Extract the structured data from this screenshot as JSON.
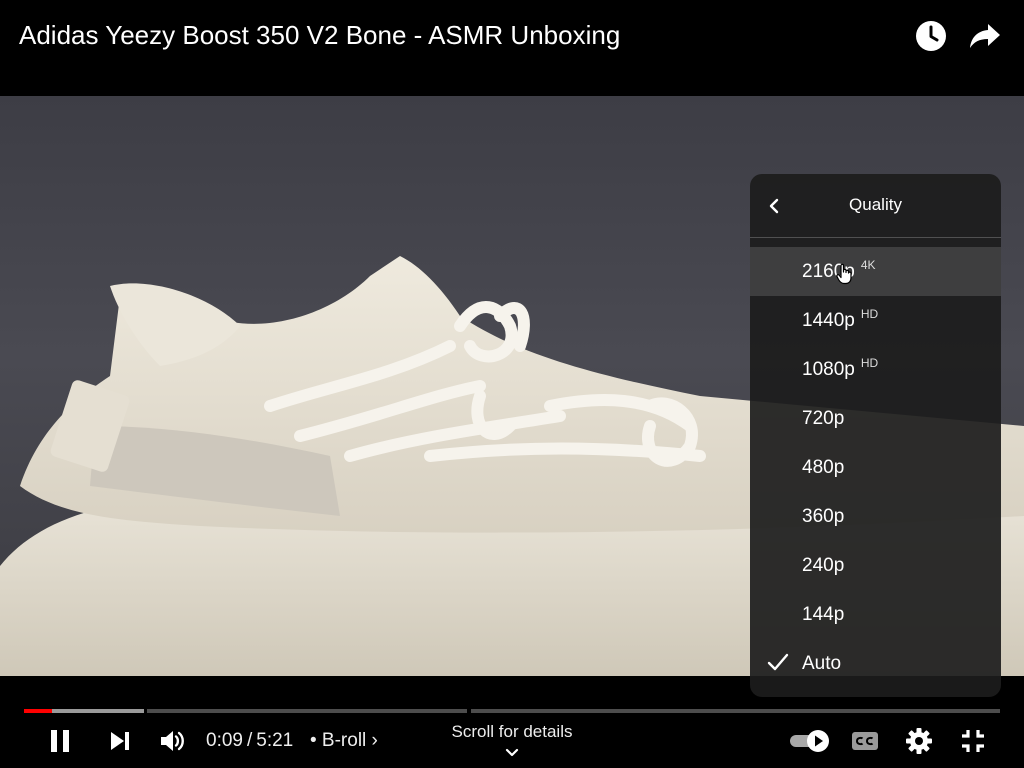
{
  "header": {
    "title": "Adidas Yeezy Boost 350 V2 Bone - ASMR Unboxing",
    "icons": [
      "watch-later-icon",
      "share-icon"
    ]
  },
  "quality_menu": {
    "title": "Quality",
    "back_icon": "chevron-left-icon",
    "options": [
      {
        "label": "2160p",
        "badge": "4K",
        "selected": false,
        "hovered": true
      },
      {
        "label": "1440p",
        "badge": "HD",
        "selected": false
      },
      {
        "label": "1080p",
        "badge": "HD",
        "selected": false
      },
      {
        "label": "720p",
        "badge": "",
        "selected": false
      },
      {
        "label": "480p",
        "badge": "",
        "selected": false
      },
      {
        "label": "360p",
        "badge": "",
        "selected": false
      },
      {
        "label": "240p",
        "badge": "",
        "selected": false
      },
      {
        "label": "144p",
        "badge": "",
        "selected": false
      },
      {
        "label": "Auto",
        "badge": "",
        "selected": true
      }
    ]
  },
  "controls": {
    "current_time": "0:09",
    "separator": "/",
    "duration": "5:21",
    "chapter": "• B-roll ›",
    "scroll_hint": "Scroll for details",
    "progress_played_fraction": 0.028,
    "autoplay_on": true,
    "icons": [
      "pause-icon",
      "next-icon",
      "volume-icon",
      "autoplay-toggle-icon",
      "captions-icon",
      "settings-gear-icon",
      "exit-fullscreen-icon"
    ]
  },
  "colors": {
    "progress_played": "#ff0000",
    "menu_background": "#1c1c1c",
    "background": "#000000"
  }
}
